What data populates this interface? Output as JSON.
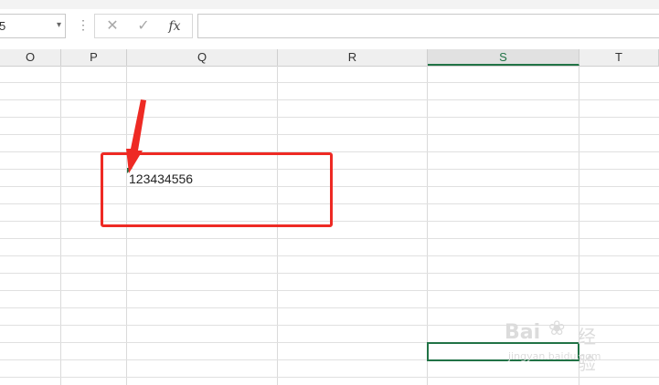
{
  "formula_bar": {
    "name_box_value": "5",
    "name_box_arrow": "▾",
    "separator": "⋮",
    "cancel_symbol": "✕",
    "enter_symbol": "✓",
    "function_symbol": "fx",
    "formula_value": ""
  },
  "columns": [
    {
      "label": "O",
      "selected": false
    },
    {
      "label": "P",
      "selected": false
    },
    {
      "label": "Q",
      "selected": false
    },
    {
      "label": "R",
      "selected": false
    },
    {
      "label": "S",
      "selected": true
    },
    {
      "label": "T",
      "selected": false
    }
  ],
  "cells": {
    "q_value": "123434556"
  },
  "colors": {
    "accent": "#217346",
    "annotation": "#ee2a24"
  },
  "watermark": {
    "brand": "Bai",
    "suffix": "经验",
    "url": "jingyan.baidu.com"
  }
}
